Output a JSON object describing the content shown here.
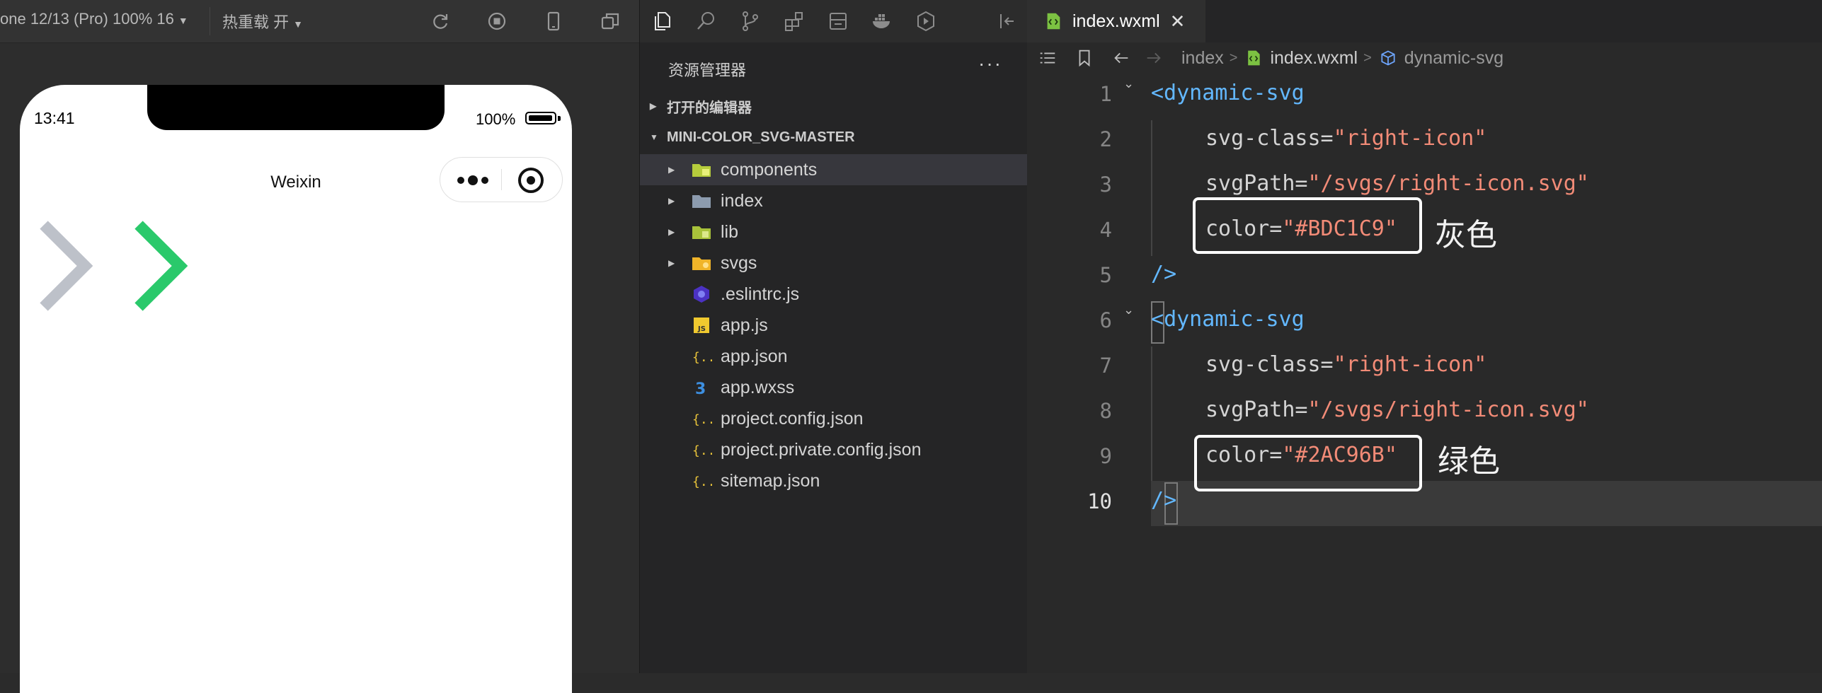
{
  "simulator": {
    "device_label": "one 12/13 (Pro) 100% 16",
    "hot_reload_label": "热重载 开",
    "time": "13:41",
    "battery": "100%",
    "nav_title": "Weixin",
    "chevrons": [
      {
        "color": "#BDC1C9"
      },
      {
        "color": "#2AC96B"
      }
    ]
  },
  "explorer": {
    "title": "资源管理器",
    "more": "···",
    "open_editors": "打开的编辑器",
    "project": "MINI-COLOR_SVG-MASTER",
    "items": [
      {
        "label": "components",
        "type": "folder",
        "icon": "components-folder-icon"
      },
      {
        "label": "index",
        "type": "folder",
        "icon": "folder-icon"
      },
      {
        "label": "lib",
        "type": "folder",
        "icon": "lib-folder-icon"
      },
      {
        "label": "svgs",
        "type": "folder",
        "icon": "svgs-folder-icon"
      },
      {
        "label": ".eslintrc.js",
        "type": "file",
        "icon": "eslint-icon"
      },
      {
        "label": "app.js",
        "type": "file",
        "icon": "js-icon"
      },
      {
        "label": "app.json",
        "type": "file",
        "icon": "json-icon"
      },
      {
        "label": "app.wxss",
        "type": "file",
        "icon": "css-icon"
      },
      {
        "label": "project.config.json",
        "type": "file",
        "icon": "json-icon"
      },
      {
        "label": "project.private.config.json",
        "type": "file",
        "icon": "json-icon"
      },
      {
        "label": "sitemap.json",
        "type": "file",
        "icon": "json-icon"
      }
    ]
  },
  "editor": {
    "tab": "index.wxml",
    "tab_close": "✕",
    "breadcrumb": [
      "index",
      "index.wxml",
      "dynamic-svg"
    ],
    "line_numbers": [
      "1",
      "2",
      "3",
      "4",
      "5",
      "6",
      "7",
      "8",
      "9",
      "10"
    ],
    "lines": {
      "l1_tag": "<dynamic-svg",
      "l2_attr": "svg-class=",
      "l2_val": "\"right-icon\"",
      "l3_attr": "svgPath=",
      "l3_val": "\"/svgs/right-icon.svg\"",
      "l4_attr": "color=",
      "l4_val": "\"#BDC1C9\"",
      "l5_tag": "/>",
      "l6_lt": "<",
      "l6_tag": "dynamic-svg",
      "l7_attr": "svg-class=",
      "l7_val": "\"right-icon\"",
      "l8_attr": "svgPath=",
      "l8_val": "\"/svgs/right-icon.svg\"",
      "l9_attr": "color=",
      "l9_val": "\"#2AC96B\"",
      "l10_slash": "/",
      "l10_gt": ">"
    },
    "annotations": {
      "gray": "灰色",
      "green": "绿色"
    }
  }
}
